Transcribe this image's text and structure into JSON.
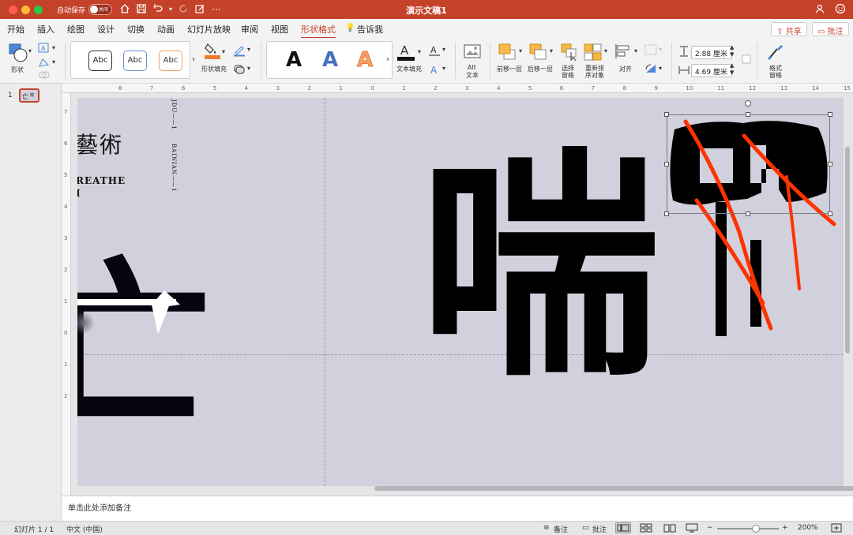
{
  "window": {
    "title": "演示文稿1",
    "autosave_label": "自动保存",
    "autosave_state": "关闭"
  },
  "titlebar_icons": [
    "home-icon",
    "save-icon",
    "undo-icon",
    "redo-icon",
    "edit-icon",
    "more-icon",
    "share-people-icon",
    "smiley-icon"
  ],
  "tabs": [
    {
      "label": "开始"
    },
    {
      "label": "插入"
    },
    {
      "label": "绘图"
    },
    {
      "label": "设计"
    },
    {
      "label": "切换"
    },
    {
      "label": "动画"
    },
    {
      "label": "幻灯片放映"
    },
    {
      "label": "审阅"
    },
    {
      "label": "视图"
    },
    {
      "label": "形状格式"
    },
    {
      "label": "告诉我"
    }
  ],
  "active_tab": "形状格式",
  "header_buttons": {
    "share": "共享",
    "comment": "批注"
  },
  "ribbon": {
    "shape_label": "形状",
    "style_samples": [
      "Abc",
      "Abc",
      "Abc"
    ],
    "shape_fill_label": "形状填充",
    "wordart_samples": [
      "A",
      "A",
      "A"
    ],
    "text_fill_label": "文本填充",
    "alt_text_label": [
      "Alt",
      "文本"
    ],
    "bring_forward": "前移一层",
    "send_backward": "后移一层",
    "selection_pane": [
      "选择",
      "窗格"
    ],
    "reorder_objects": [
      "重新排",
      "序对象"
    ],
    "align": "对齐",
    "height_value": "2.88 厘米",
    "width_value": "4.69 厘米",
    "format_pane": [
      "格式",
      "窗格"
    ]
  },
  "colors": {
    "accent": "#c4412a",
    "slide_bg": "#d0d1dc",
    "wordart_blue": "#4472c4",
    "wordart_orange": "#f4a16b",
    "stroke_red": "#ff3300"
  },
  "ruler": {
    "h_numbers": [
      "8",
      "7",
      "6",
      "5",
      "4",
      "3",
      "2",
      "1",
      "0",
      "1",
      "2",
      "3",
      "4",
      "5",
      "6",
      "7",
      "8",
      "9",
      "10",
      "11",
      "12",
      "13",
      "14",
      "15"
    ],
    "v_numbers": [
      "7",
      "6",
      "5",
      "4",
      "3",
      "2",
      "1",
      "0",
      "1",
      "2"
    ]
  },
  "thumbnail": {
    "number": "1"
  },
  "slide": {
    "heading_partial": "藝術",
    "sub_line1": "REATHE",
    "sub_line2": "I",
    "vertical_text_1": "JDU——1",
    "vertical_text_2": "BAINIAN——1",
    "big_char": "喘",
    "left_char": "亡"
  },
  "notes_placeholder": "单击此处添加备注",
  "status": {
    "slide_count": "幻灯片 1 / 1",
    "language": "中文 (中国)",
    "notes": "备注",
    "comments": "批注",
    "zoom": "200%",
    "zoom_minus": "−",
    "zoom_plus": "+"
  }
}
